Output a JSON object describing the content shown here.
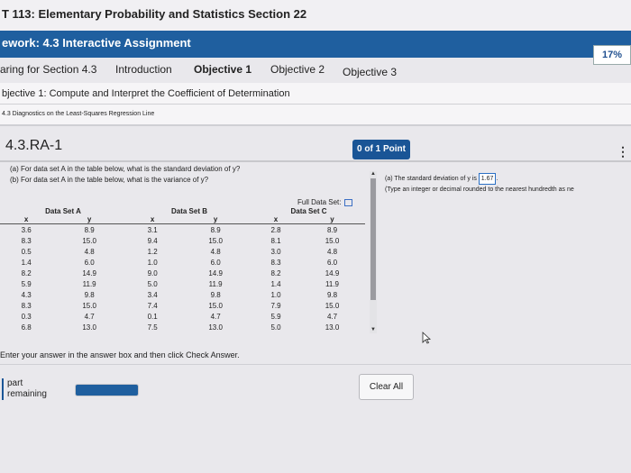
{
  "header": {
    "course_title": "T 113: Elementary Probability and Statistics Section 22",
    "homework_title": "ework: 4.3 Interactive Assignment",
    "progress_pct": "17%"
  },
  "tabs": [
    {
      "label": "aring for Section 4.3"
    },
    {
      "label": "Introduction"
    },
    {
      "label": "Objective 1"
    },
    {
      "label": "Objective 2"
    },
    {
      "label": "Objective 3"
    }
  ],
  "objective": "bjective 1: Compute and Interpret the Coefficient of Determination",
  "section_link": "4.3 Diagnostics on the Least-Squares Regression Line",
  "problem": {
    "id": "4.3.RA-1",
    "points": "0 of 1 Point",
    "question_a": "(a) For data set A in the table below, what is the standard deviation of y?",
    "question_b": "(b) For data set A in the table below, what is the variance of y?",
    "full_data_label": "Full Data Set"
  },
  "table": {
    "set_headers": [
      "Data Set A",
      "Data Set B",
      "Data Set C"
    ],
    "col_headers": [
      "x",
      "y",
      "x",
      "y",
      "x",
      "y"
    ],
    "rows": [
      [
        "3.6",
        "8.9",
        "3.1",
        "8.9",
        "2.8",
        "8.9"
      ],
      [
        "8.3",
        "15.0",
        "9.4",
        "15.0",
        "8.1",
        "15.0"
      ],
      [
        "0.5",
        "4.8",
        "1.2",
        "4.8",
        "3.0",
        "4.8"
      ],
      [
        "1.4",
        "6.0",
        "1.0",
        "6.0",
        "8.3",
        "6.0"
      ],
      [
        "8.2",
        "14.9",
        "9.0",
        "14.9",
        "8.2",
        "14.9"
      ],
      [
        "5.9",
        "11.9",
        "5.0",
        "11.9",
        "1.4",
        "11.9"
      ],
      [
        "4.3",
        "9.8",
        "3.4",
        "9.8",
        "1.0",
        "9.8"
      ],
      [
        "8.3",
        "15.0",
        "7.4",
        "15.0",
        "7.9",
        "15.0"
      ],
      [
        "0.3",
        "4.7",
        "0.1",
        "4.7",
        "5.9",
        "4.7"
      ],
      [
        "6.8",
        "13.0",
        "7.5",
        "13.0",
        "5.0",
        "13.0"
      ]
    ]
  },
  "answer": {
    "prefix": "(a) The standard deviation of y is",
    "value": "1.67",
    "hint": "(Type an integer or decimal rounded to the nearest hundredth as ne"
  },
  "instructions": "Enter your answer in the answer box and then click Check Answer.",
  "footer": {
    "part_label": "part",
    "remaining_label": "remaining",
    "clear_all": "Clear All"
  }
}
